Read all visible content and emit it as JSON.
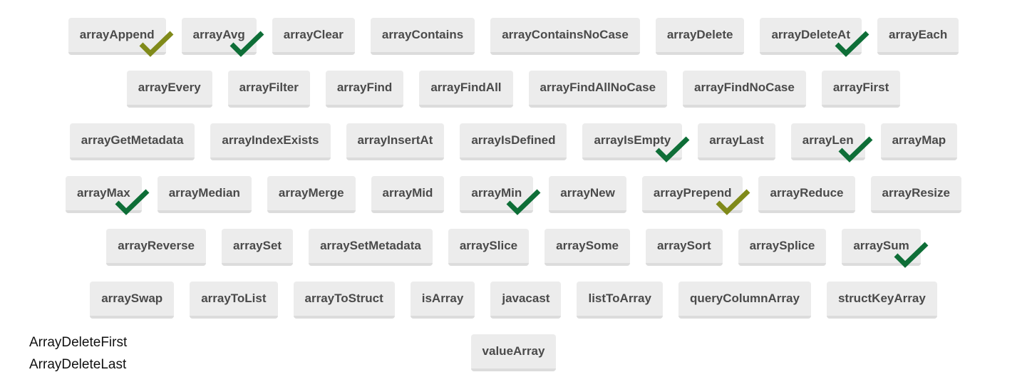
{
  "colors": {
    "check_olive": "#808a1a",
    "check_green": "#0e6e37",
    "button_bg": "#ececec"
  },
  "rows": [
    [
      {
        "label": "arrayAppend",
        "check": "olive"
      },
      {
        "label": "arrayAvg",
        "check": "green"
      },
      {
        "label": "arrayClear"
      },
      {
        "label": "arrayContains"
      },
      {
        "label": "arrayContainsNoCase"
      },
      {
        "label": "arrayDelete"
      },
      {
        "label": "arrayDeleteAt",
        "check": "green"
      },
      {
        "label": "arrayEach"
      }
    ],
    [
      {
        "label": "arrayEvery"
      },
      {
        "label": "arrayFilter"
      },
      {
        "label": "arrayFind"
      },
      {
        "label": "arrayFindAll"
      },
      {
        "label": "arrayFindAllNoCase"
      },
      {
        "label": "arrayFindNoCase"
      },
      {
        "label": "arrayFirst"
      }
    ],
    [
      {
        "label": "arrayGetMetadata"
      },
      {
        "label": "arrayIndexExists"
      },
      {
        "label": "arrayInsertAt"
      },
      {
        "label": "arrayIsDefined"
      },
      {
        "label": "arrayIsEmpty",
        "check": "green"
      },
      {
        "label": "arrayLast"
      },
      {
        "label": "arrayLen",
        "check": "green"
      },
      {
        "label": "arrayMap"
      }
    ],
    [
      {
        "label": "arrayMax",
        "check": "green"
      },
      {
        "label": "arrayMedian"
      },
      {
        "label": "arrayMerge"
      },
      {
        "label": "arrayMid"
      },
      {
        "label": "arrayMin",
        "check": "green"
      },
      {
        "label": "arrayNew"
      },
      {
        "label": "arrayPrepend",
        "check": "olive"
      },
      {
        "label": "arrayReduce"
      },
      {
        "label": "arrayResize"
      }
    ],
    [
      {
        "label": "arrayReverse"
      },
      {
        "label": "arraySet"
      },
      {
        "label": "arraySetMetadata"
      },
      {
        "label": "arraySlice"
      },
      {
        "label": "arraySome"
      },
      {
        "label": "arraySort"
      },
      {
        "label": "arraySplice"
      },
      {
        "label": "arraySum",
        "check": "green"
      }
    ],
    [
      {
        "label": "arraySwap"
      },
      {
        "label": "arrayToList"
      },
      {
        "label": "arrayToStruct"
      },
      {
        "label": "isArray"
      },
      {
        "label": "javacast"
      },
      {
        "label": "listToArray"
      },
      {
        "label": "queryColumnArray"
      },
      {
        "label": "structKeyArray"
      }
    ],
    [
      {
        "label": "valueArray"
      }
    ]
  ],
  "notes": [
    "ArrayDeleteFirst",
    "ArrayDeleteLast"
  ]
}
